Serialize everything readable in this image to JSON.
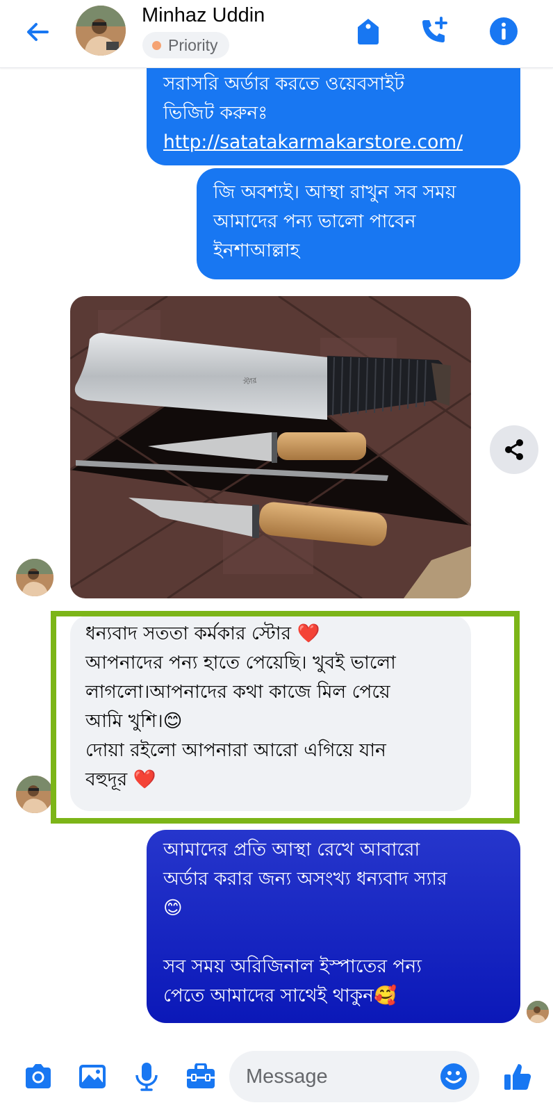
{
  "header": {
    "contact_name": "Minhaz Uddin",
    "priority_label": "Priority",
    "accent_color": "#1877f2",
    "icons": [
      "back-arrow-icon",
      "tag-icon",
      "call-add-icon",
      "info-icon"
    ]
  },
  "messages": [
    {
      "sender": "me",
      "lines": [
        "সরাসরি অর্ডার করতে ওয়েবসাইট",
        "ভিজিট করুনঃ"
      ],
      "link": "http://satatakarmakarstore.com/"
    },
    {
      "sender": "me",
      "text": "জি অবশ্যই। আস্থা রাখুন সব সময়\nআমাদের পন্য ভালো পাবেন\nইনশাআল্লাহ"
    },
    {
      "sender": "contact",
      "type": "photo"
    },
    {
      "sender": "contact",
      "text": "ধন্যবাদ সততা কর্মকার স্টোর ❤️\nআপনাদের পন্য হাতে পেয়েছি। খুবই ভালো\nলাগলো।আপনাদের কথা কাজে মিল পেয়ে\nআমি খুশি।😊\nদোয়া রইলো আপনারা আরো এগিয়ে যান\nবহুদূর ❤️"
    },
    {
      "sender": "me",
      "text": "আমাদের প্রতি আস্থা রেখে আবারো\nঅর্ডার করার জন্য অসংখ্য ধন্যবাদ স্যার\n😊\n\nসব সময় অরিজিনাল ইস্পাতের পন্য\nপেতে আমাদের সাথেই থাকুন🥰"
    }
  ],
  "composer": {
    "placeholder": "Message",
    "icons": [
      "camera-icon",
      "gallery-icon",
      "microphone-icon",
      "toolbox-icon",
      "emoji-icon",
      "like-icon"
    ]
  },
  "highlight_color": "#7cb518"
}
